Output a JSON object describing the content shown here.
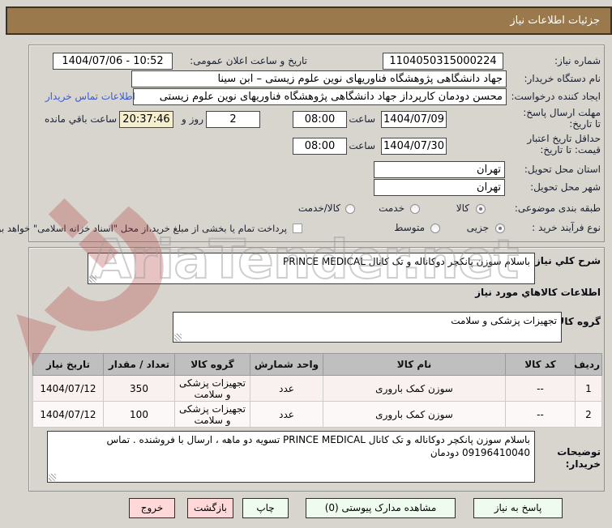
{
  "title": "جزئیات اطلاعات نیاز",
  "watermark": {
    "text": "AriaTender.net"
  },
  "form": {
    "need_number": {
      "label": "شماره نیاز:",
      "value": "1104050315000224"
    },
    "announce": {
      "label": "تاریخ و ساعت اعلان عمومی:",
      "value": "1404/07/06 - 10:52"
    },
    "buyer_org": {
      "label": "نام دستگاه خریدار:",
      "value": "جهاد دانشگاهی پژوهشگاه فناوریهای نوین علوم زیستی – ابن سینا"
    },
    "creator": {
      "label": "ایجاد کننده درخواست:",
      "value": "محسن دودمان کارپرداز جهاد دانشگاهی پژوهشگاه فناوریهای نوین علوم زیستی",
      "contact_link": "اطلاعات تماس خریدار"
    },
    "reply_deadline": {
      "label": "مهلت ارسال پاسخ: تا تاریخ:",
      "date": "1404/07/09",
      "hour_label": "ساعت",
      "time": "08:00",
      "days": "2",
      "days_label": "روز و",
      "countdown": "20:37:46",
      "remaining_label": "ساعت باقي مانده"
    },
    "price_validity": {
      "label": "حداقل تاریخ اعتبار قیمت: تا تاریخ:",
      "date": "1404/07/30",
      "hour_label": "ساعت",
      "time": "08:00"
    },
    "province": {
      "label": "استان محل تحویل:",
      "value": "تهران"
    },
    "city": {
      "label": "شهر محل تحویل:",
      "value": "تهران"
    },
    "classification": {
      "label": "طبقه بندی موضوعی:",
      "options": [
        "کالا",
        "خدمت",
        "کالا/خدمت"
      ],
      "selected": "کالا"
    },
    "process_type": {
      "label": "نوع فرآیند خرید :",
      "options": [
        "جزیی",
        "متوسط"
      ],
      "selected": "جزیی",
      "checkbox_label": "پرداخت تمام یا بخشی از مبلغ خرید،از محل \"اسناد خزانه اسلامی\" خواهد بود."
    }
  },
  "description": {
    "label": "شرح كلي نياز:",
    "value": "باسلام سوزن پانکچر دوکاناله و تک کانال PRINCE MEDICAL"
  },
  "goods": {
    "heading": "اطلاعات كالاهاي مورد نياز",
    "group_label": "گروه کالا:",
    "group_value": "تجهیزات پزشکی و سلامت"
  },
  "table": {
    "headers": [
      "ردیف",
      "کد کالا",
      "نام کالا",
      "واحد شمارش",
      "گروه کالا",
      "تعداد / مقدار",
      "تاریخ نیاز"
    ],
    "rows": [
      {
        "row": "1",
        "code": "--",
        "name": "سوزن کمک باروری",
        "unit": "عدد",
        "group": "تجهیزات پزشکی و سلامت",
        "qty": "350",
        "date": "1404/07/12"
      },
      {
        "row": "2",
        "code": "--",
        "name": "سوزن کمک باروری",
        "unit": "عدد",
        "group": "تجهیزات پزشکی و سلامت",
        "qty": "100",
        "date": "1404/07/12"
      }
    ]
  },
  "notes": {
    "label": "توضیحات خریدار:",
    "value": "باسلام سوزن پانکچر دوکاناله و تک کانال PRINCE MEDICAL  تسویه دو ماهه ، ارسال با فروشنده . تماس 09196410040 دودمان"
  },
  "buttons": {
    "reply": "پاسخ به نیاز",
    "attachments": "مشاهده مدارک پیوستی (0)",
    "print": "چاپ",
    "back": "بازگشت",
    "exit": "خروج"
  },
  "colors": {
    "header_bg": "#9a7a4c",
    "link": "#3b5bcd",
    "countdown_bg": "#f5efcf",
    "button_green": "#eefbee",
    "button_pink": "#ffd9d9"
  }
}
